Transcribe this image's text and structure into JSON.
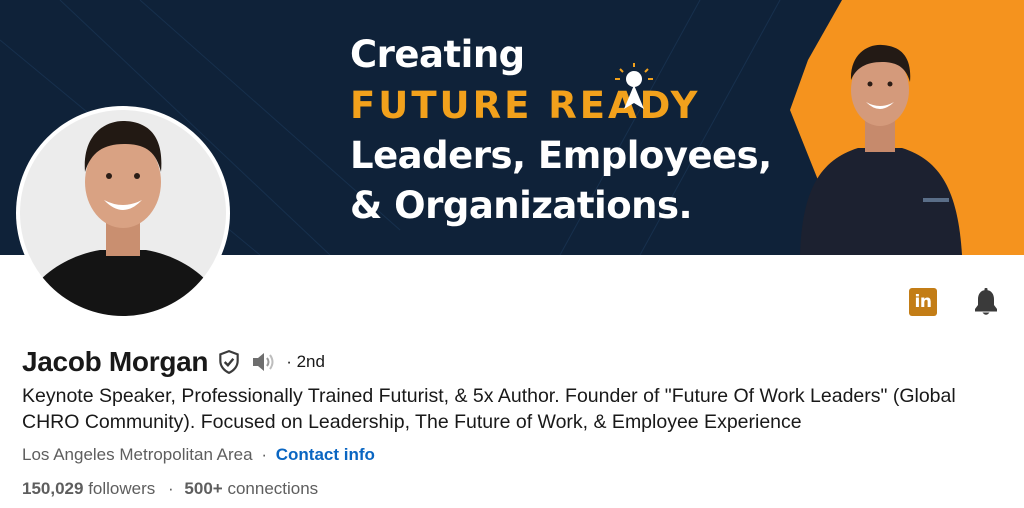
{
  "banner": {
    "line1": "Creating",
    "line2": "FUTURE READY",
    "line3": "Leaders, Employees,",
    "line4": "& Organizations.",
    "colors": {
      "background": "#0f2239",
      "accent": "#f2a11c",
      "panel": "#f5931e"
    }
  },
  "actions": {
    "linkedin_label": "in",
    "linkedin_color": "#c37d16",
    "bell_icon": "bell-icon"
  },
  "profile": {
    "name": "Jacob Morgan",
    "degree": "· 2nd",
    "headline": "Keynote Speaker, Professionally Trained Futurist, & 5x Author. Founder of \"Future Of Work Leaders\" (Global CHRO Community). Focused on Leadership, The Future of Work, & Employee Experience",
    "location": "Los Angeles Metropolitan Area",
    "separator": "·",
    "contact_info": "Contact info",
    "followers_count": "150,029",
    "followers_label": "followers",
    "connections_count": "500+",
    "connections_label": "connections",
    "link_color": "#0a66c2"
  }
}
